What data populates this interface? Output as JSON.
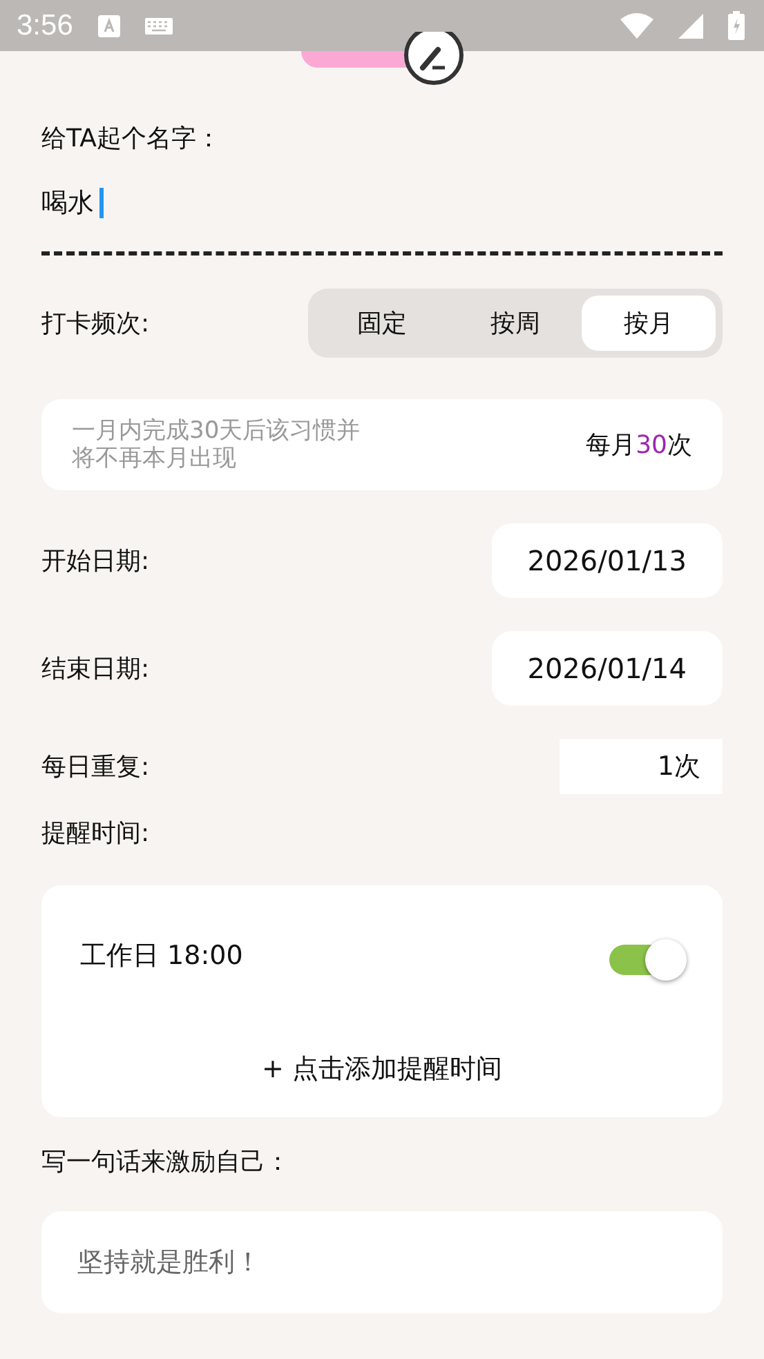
{
  "status_bar": {
    "time": "3:56"
  },
  "name_field": {
    "label": "给TA起个名字：",
    "value": "喝水"
  },
  "frequency": {
    "label": "打卡频次:",
    "options": [
      {
        "label": "固定",
        "selected": false
      },
      {
        "label": "按周",
        "selected": false
      },
      {
        "label": "按月",
        "selected": true
      }
    ]
  },
  "rule": {
    "description_lines": [
      "一月内完成30天后该习惯并",
      "将不再本月出现"
    ],
    "summary_prefix": "每月",
    "summary_count": "30",
    "summary_suffix": "次"
  },
  "dates": [
    {
      "label": "开始日期:",
      "value": "2026/01/13"
    },
    {
      "label": "结束日期:",
      "value": "2026/01/14"
    }
  ],
  "repeat": {
    "label": "每日重复:",
    "value": "1次"
  },
  "reminders": {
    "label": "提醒时间:",
    "items": [
      {
        "text": "工作日  18:00",
        "on": true
      }
    ],
    "add_text": "+ 点击添加提醒时间"
  },
  "motto": {
    "label": "写一句话来激励自己：",
    "value": "坚持就是胜利！"
  }
}
